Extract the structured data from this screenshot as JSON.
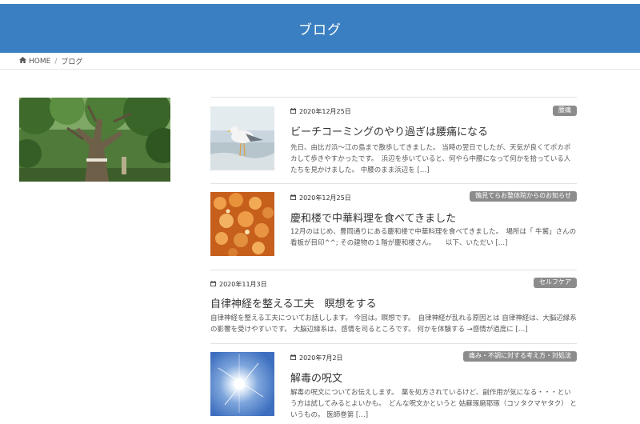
{
  "header": {
    "title": "ブログ"
  },
  "breadcrumb": {
    "home": "HOME",
    "sep": "/",
    "current": "ブログ"
  },
  "posts": [
    {
      "date": "2020年12月25日",
      "category": "腰痛",
      "title": "ビーチコーミングのやり過ぎは腰痛になる",
      "excerpt": "先日、由比ガ浜～江の島まで散歩してきました。 当時の翌日でしたが、天気が良くてポカポカして歩きやすかったです。　浜辺を歩いていると、何やら中腰になって何かを拾っている人たちを見かけました。 中腰のまま浜辺を […]"
    },
    {
      "date": "2020年12月25日",
      "category": "鵠見てらお整体院からのお知らせ",
      "title": "慶和楼で中華料理を食べてきました",
      "excerpt": "12月のはじめ、豊岡通りにある慶和楼で中華料理を食べてきました。　場所は「 牛鷲」さんの看板が目印^^; その建物の１階が慶和楼さん。　　以下、いただい […]"
    },
    {
      "date": "2020年11月3日",
      "category": "セルフケア",
      "title": "自律神経を整える工夫　瞑想をする",
      "excerpt": "自律神経を整える工夫についてお話しします。 今回は。瞑想です。　自律神経が乱れる原因とは 自律神経は、大脳辺縁系の影響を受けやすいです。 大脳辺縁系は、感情を司るところです。 何かを体験する →感情が過度に […]"
    },
    {
      "date": "2020年7月2日",
      "category": "痛み・不調に対する考え方・対処法",
      "title": "解毒の呪文",
      "excerpt": "解毒の呪文についてお伝えします。　薬を処方されているけど、副作用が気になる・・・という方は試してみるとよいかも。　どんな呪文かというと 姑蘇琢磨耶琢（コソタクマヤタク） というもの。 医師巻第 […]"
    }
  ],
  "colors": {
    "header": "#3a7fc1",
    "category_badge": "#8c8c8c"
  },
  "icons": {
    "home": "home-icon",
    "date": "calendar-icon"
  }
}
